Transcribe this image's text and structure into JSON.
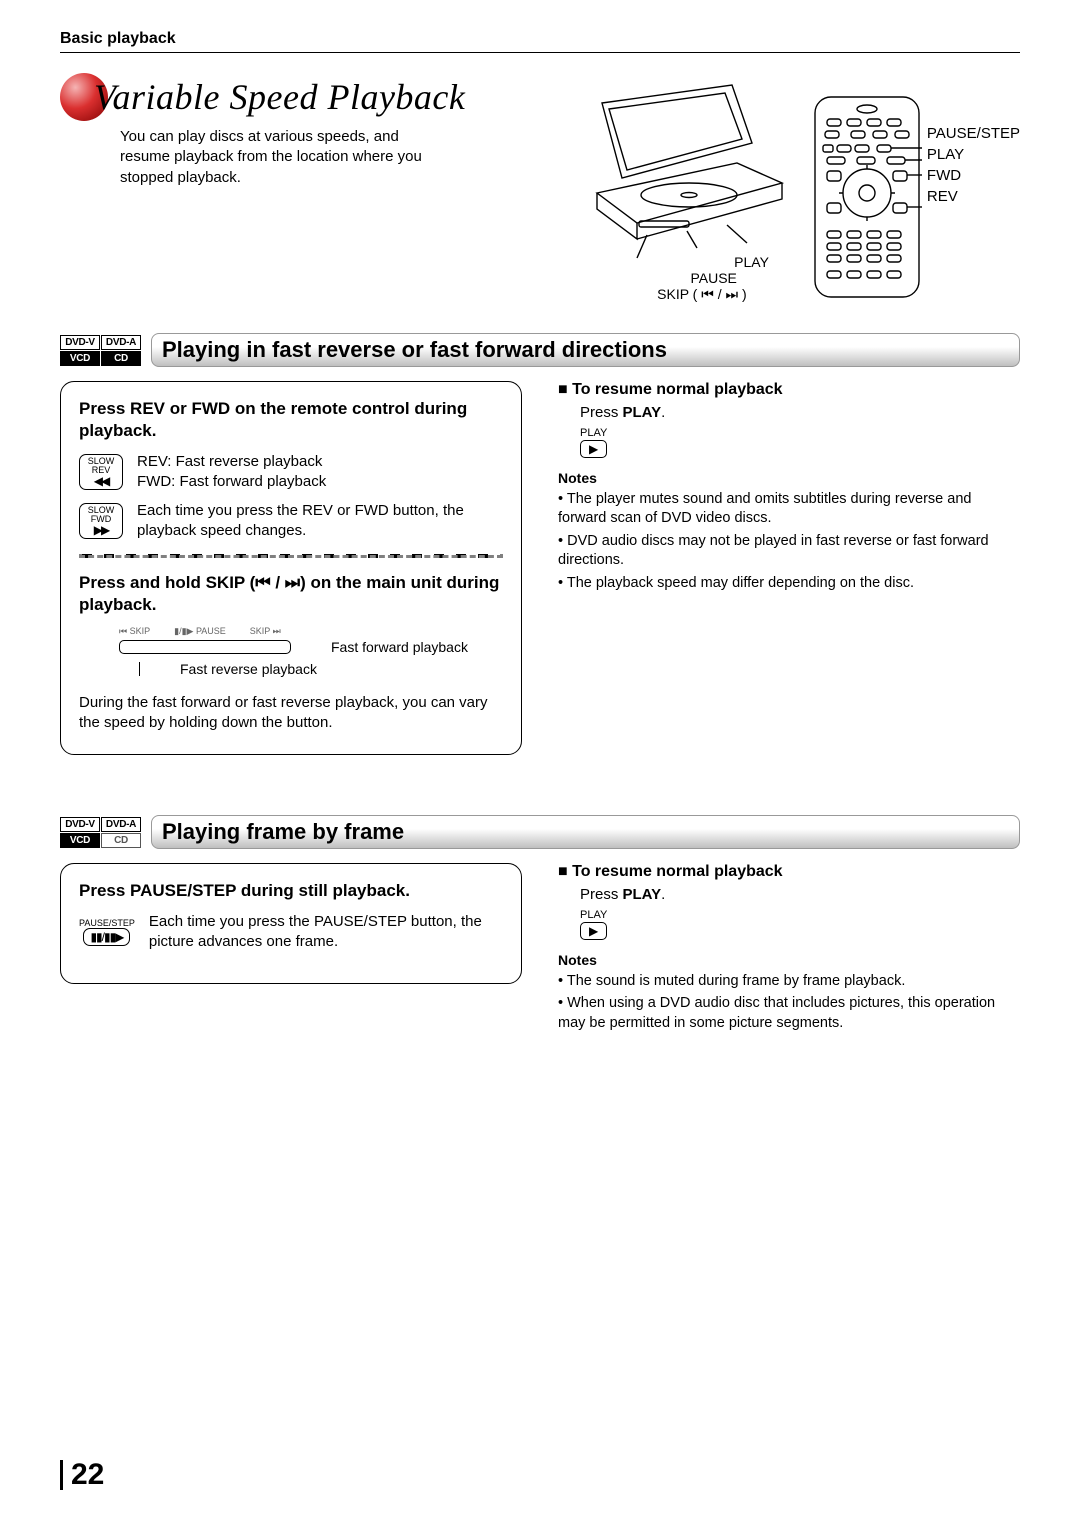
{
  "header": {
    "section": "Basic playback"
  },
  "title": "Variable Speed Playback",
  "intro": "You can play discs at various speeds, and resume playback from the location where you stopped playback.",
  "device_labels": {
    "play": "PLAY",
    "pause": "PAUSE",
    "skip": "SKIP ( ⏮ / ⏭ )"
  },
  "remote_labels": {
    "pause_step": "PAUSE/STEP",
    "play": "PLAY",
    "fwd": "FWD",
    "rev": "REV"
  },
  "section1": {
    "badges": [
      "DVD-V",
      "DVD-A",
      "VCD",
      "CD"
    ],
    "title": "Playing in fast reverse or fast forward directions",
    "left": {
      "h1": "Press REV or FWD on the remote control during playback.",
      "icon1_top": "SLOW",
      "icon1_mid": "REV",
      "icon1_sym": "◀◀",
      "desc1a": "REV: Fast reverse playback",
      "desc1b": "FWD: Fast forward playback",
      "icon2_top": "SLOW",
      "icon2_mid": "FWD",
      "icon2_sym": "▶▶",
      "desc2": "Each time you press the REV or FWD button, the playback speed changes.",
      "h2": "Press and hold SKIP (⏮ / ⏭) on the main unit during playback.",
      "unit_labels": {
        "a": "⏮ SKIP",
        "b": "▮/▮▶ PAUSE",
        "c": "SKIP ⏭"
      },
      "unit_cap1": "Fast forward playback",
      "unit_cap2": "Fast reverse playback",
      "para": "During the fast forward or fast reverse playback, you can vary the speed by holding down the button."
    },
    "right": {
      "resume_h": "To resume normal playback",
      "resume_t_pre": "Press ",
      "resume_t_bold": "PLAY",
      "resume_t_post": ".",
      "play_lbl": "PLAY",
      "notes_h": "Notes",
      "notes": [
        "The player mutes sound and omits subtitles during reverse and forward scan of DVD video discs.",
        "DVD audio discs may not be played in fast reverse or fast forward directions.",
        "The playback speed may differ depending on the disc."
      ]
    }
  },
  "section2": {
    "badges": [
      "DVD-V",
      "DVD-A",
      "VCD",
      "CD"
    ],
    "title": "Playing frame by frame",
    "left": {
      "h1": "Press PAUSE/STEP during still playback.",
      "icon_top": "PAUSE/STEP",
      "icon_sym": "▮▮/▮▮▶",
      "desc": "Each time you press the PAUSE/STEP button, the picture advances one frame."
    },
    "right": {
      "resume_h": "To resume normal playback",
      "resume_t_pre": "Press ",
      "resume_t_bold": "PLAY",
      "resume_t_post": ".",
      "play_lbl": "PLAY",
      "notes_h": "Notes",
      "notes": [
        "The sound is muted during frame by frame playback.",
        "When using a DVD audio disc that includes pictures, this operation may be permitted in some picture segments."
      ]
    }
  },
  "page_number": "22"
}
